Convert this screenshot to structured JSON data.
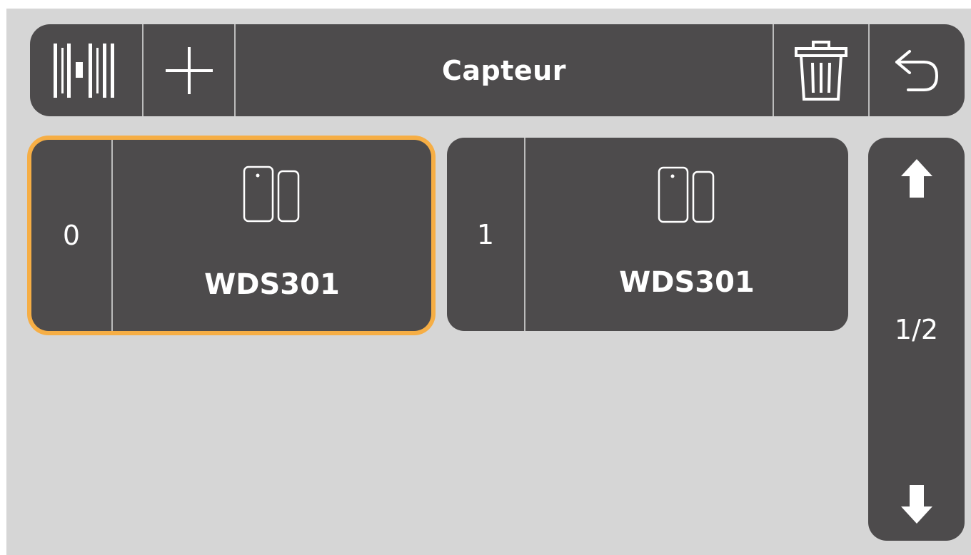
{
  "header": {
    "title": "Capteur",
    "icons": {
      "left1": "barcode-icon",
      "left2": "plus-icon",
      "right1": "trash-icon",
      "right2": "back-arrow-icon"
    }
  },
  "cards": [
    {
      "index": "0",
      "name": "WDS301",
      "icon": "door-window-sensor-icon",
      "selected": true
    },
    {
      "index": "1",
      "name": "WDS301",
      "icon": "door-window-sensor-icon",
      "selected": false
    }
  ],
  "pager": {
    "label": "1/2",
    "up_icon": "arrow-up-icon",
    "down_icon": "arrow-down-icon"
  },
  "colors": {
    "background": "#d6d6d6",
    "panel": "#4d4b4c",
    "selected_outline": "#f6ae45",
    "divider": "#bcbcbc",
    "text": "#ffffff"
  }
}
